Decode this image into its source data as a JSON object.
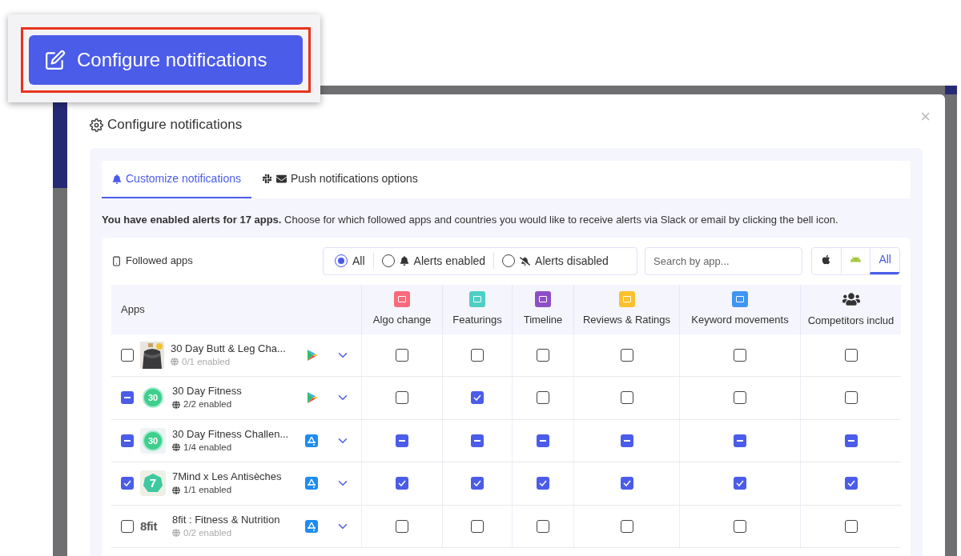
{
  "callout": {
    "label": "Configure notifications"
  },
  "modal": {
    "title": "Configure notifications",
    "close": "×",
    "tabs": [
      {
        "label": "Customize notifications",
        "kind": "bell",
        "selected": true
      },
      {
        "label": "Push notifications options",
        "kind": "slack_mail",
        "selected": false
      }
    ],
    "info": "**You have enabled alerts for 17 apps.** Choose for which followed apps and countries you would like to receive alerts via Slack or email by clicking the bell icon.",
    "followed_label": "Followed apps",
    "filters": [
      {
        "label": "All",
        "kind": "plain",
        "selected": true
      },
      {
        "label": "Alerts enabled",
        "kind": "bell",
        "selected": false
      },
      {
        "label": "Alerts disabled",
        "kind": "bell_off",
        "selected": false
      }
    ],
    "search": {
      "placeholder": "Search by app..."
    },
    "platforms": [
      {
        "kind": "apple",
        "selected": false
      },
      {
        "kind": "android",
        "selected": false
      },
      {
        "kind": "all",
        "label": "All",
        "selected": true
      }
    ],
    "table": {
      "apps_heading": "Apps",
      "columns": [
        {
          "label": "Algo change",
          "kind": "square",
          "color": "#fb6b7b"
        },
        {
          "label": "Featurings",
          "kind": "square",
          "color": "#4fcfc4"
        },
        {
          "label": "Timeline",
          "kind": "square",
          "color": "#8e4fc4"
        },
        {
          "label": "Reviews & Ratings",
          "kind": "square",
          "color": "#fbc02d"
        },
        {
          "label": "Keyword movements",
          "kind": "square",
          "color": "#3f95f2"
        },
        {
          "label": "Competitors includ",
          "kind": "users",
          "color": "#333333"
        }
      ],
      "rows": [
        {
          "kind": "box",
          "checked": false,
          "name": "30 Day Butt & Leg Cha...",
          "enabled": "0/1 enabled",
          "disabled": true,
          "store": {
            "kind": "google_play"
          },
          "cells": [
            {
              "kind": "box",
              "checked": false
            },
            {
              "kind": "box",
              "checked": false
            },
            {
              "kind": "box",
              "checked": false
            },
            {
              "kind": "box",
              "checked": false
            },
            {
              "kind": "box",
              "checked": false
            },
            {
              "kind": "box",
              "checked": false
            }
          ]
        },
        {
          "kind": "partial",
          "checked": true,
          "icon": {
            "kind": "circle",
            "text": "30"
          },
          "name": "30 Day Fitness",
          "enabled": "2/2 enabled",
          "disabled": false,
          "store": {
            "kind": "google_play"
          },
          "cells": [
            {
              "kind": "box",
              "checked": false
            },
            {
              "kind": "box",
              "checked": true
            },
            {
              "kind": "box",
              "checked": false
            },
            {
              "kind": "box",
              "checked": false
            },
            {
              "kind": "box",
              "checked": false
            },
            {
              "kind": "box",
              "checked": false
            }
          ]
        },
        {
          "kind": "partial",
          "checked": true,
          "icon": {
            "kind": "framed_circle",
            "text": "30"
          },
          "name": "30 Day Fitness Challen...",
          "enabled": "1/4 enabled",
          "disabled": false,
          "store": {
            "kind": "app_store"
          },
          "cells": [
            {
              "kind": "partial",
              "checked": true
            },
            {
              "kind": "partial",
              "checked": true
            },
            {
              "kind": "partial",
              "checked": true
            },
            {
              "kind": "partial",
              "checked": true
            },
            {
              "kind": "partial",
              "checked": true
            },
            {
              "kind": "partial",
              "checked": true
            }
          ]
        },
        {
          "kind": "box",
          "checked": true,
          "icon": {
            "kind": "heptagon",
            "text": "7"
          },
          "name": "7Mind x Les Antisèches",
          "enabled": "1/1 enabled",
          "disabled": false,
          "store": {
            "kind": "app_store"
          },
          "cells": [
            {
              "kind": "box",
              "checked": true
            },
            {
              "kind": "box",
              "checked": true
            },
            {
              "kind": "box",
              "checked": true
            },
            {
              "kind": "box",
              "checked": true
            },
            {
              "kind": "box",
              "checked": true
            },
            {
              "kind": "box",
              "checked": true
            }
          ]
        },
        {
          "kind": "box",
          "checked": false,
          "icon": {
            "kind": "wordmark",
            "text": "8fit"
          },
          "name": "8fit : Fitness & Nutrition",
          "enabled": "0/2 enabled",
          "disabled": true,
          "store": {
            "kind": "app_store"
          },
          "cells": [
            {
              "kind": "box",
              "checked": false
            },
            {
              "kind": "box",
              "checked": false
            },
            {
              "kind": "box",
              "checked": false
            },
            {
              "kind": "box",
              "checked": false
            },
            {
              "kind": "box",
              "checked": false
            },
            {
              "kind": "box",
              "checked": false
            }
          ]
        }
      ]
    }
  }
}
